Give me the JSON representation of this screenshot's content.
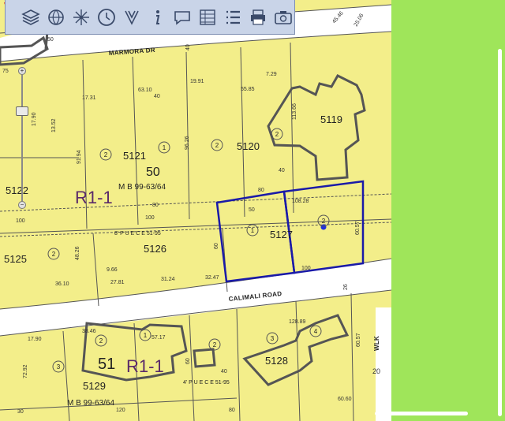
{
  "map": {
    "roads": {
      "upper": "MARMORA DR",
      "lower": "CALIMALI ROAD",
      "walk": "WLK"
    },
    "zones": [
      "R1-1",
      "R1-1"
    ],
    "lots": [
      "5121",
      "5120",
      "5119",
      "5122",
      "5125",
      "5126",
      "5127",
      "5128",
      "5129",
      "51"
    ],
    "map_book_upper": "M B 99-63/64",
    "map_book_lower": "M B 99-63/64",
    "block_number": "50",
    "easement_upper": "8' P U E C E 51-95",
    "easement_lower": "4' P U E C E 51-95",
    "circled_numbers": [
      "2",
      "1",
      "2",
      "2",
      "1",
      "2",
      "2",
      "3",
      "2",
      "3",
      "4",
      "2",
      "1"
    ],
    "dimensions": {
      "d_4546": "45.46",
      "d_2506": "25.06",
      "d_40a": "40",
      "d_50": "50",
      "d_75": "75",
      "d_1731": "17.31",
      "d_6310": "63.10",
      "d_40b": "40",
      "d_1991": "19.91",
      "d_5585": "55.85",
      "d_729": "7.29",
      "d_1352": "13.52",
      "d_1366": "113.66",
      "d_9194": "91.94",
      "d_9626": "96.26",
      "d_80a": "80",
      "d_40c": "40",
      "d_80b": "80",
      "d_50b": "50",
      "d_10828": "108.28",
      "d_100a": "100",
      "d_100b": "100",
      "d_6057": "60.57",
      "d_4826": "48.26",
      "d_60": "60",
      "d_966": "9.66",
      "d_3610": "36.10",
      "d_2781": "27.81",
      "d_3124": "31.24",
      "d_3247": "32.47",
      "d_100c": "100",
      "d_26": "26",
      "d_1790": "17.90",
      "d_3846": "38.46",
      "d_5717": "57.17",
      "d_12889": "128.89",
      "d_6057b": "60.57",
      "d_7292": "72.92",
      "d_40d": "40",
      "d_60b": "60",
      "d_20": "20",
      "d_30": "30",
      "d_120": "120",
      "d_80c": "80",
      "d_6060": "60.60",
      "d_1790b": "17.90"
    }
  },
  "toolbar": {
    "tools": [
      "layers-icon",
      "globe-icon",
      "pan-icon",
      "clock-icon",
      "measure-icon",
      "info-icon",
      "comment-icon",
      "table-icon",
      "list-icon",
      "print-icon",
      "camera-icon"
    ]
  },
  "zoom": {
    "level": 0.27,
    "plus": "+",
    "minus": "−"
  },
  "colors": {
    "parcel_fill": "#f3ee8a",
    "road": "#ffffff",
    "selection": "#1a1aa8",
    "building": "#555555",
    "side_panel": "#9fe55a"
  }
}
